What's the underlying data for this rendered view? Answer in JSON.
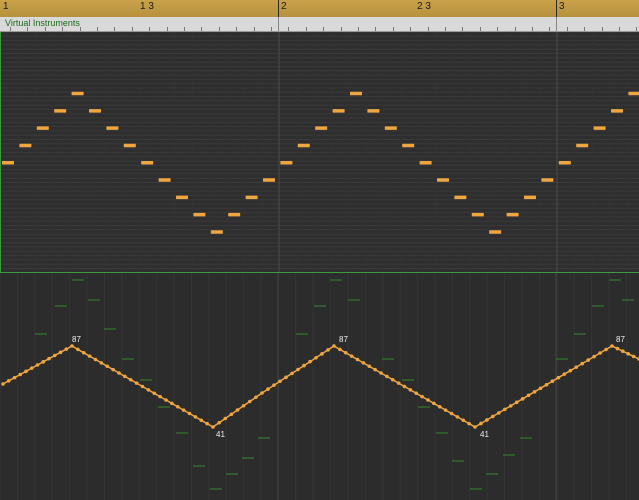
{
  "ruler": {
    "labels": [
      "1",
      "1 3",
      "2",
      "2 3",
      "3"
    ],
    "bar_color": "#2a2a2a"
  },
  "region": {
    "title": "Virtual Instruments",
    "title_color": "#1a6b1a"
  },
  "notes": {
    "color": "#f0a640",
    "count_per_cycle": 16
  },
  "automation": {
    "color": "#f0a640",
    "peak_value": "87",
    "trough_value": "41",
    "labels": [
      "87",
      "41",
      "87",
      "41",
      "87"
    ]
  },
  "colors": {
    "accent": "#f0a640",
    "ruler": "#c9a24a",
    "region_border": "#3f9a3f"
  }
}
